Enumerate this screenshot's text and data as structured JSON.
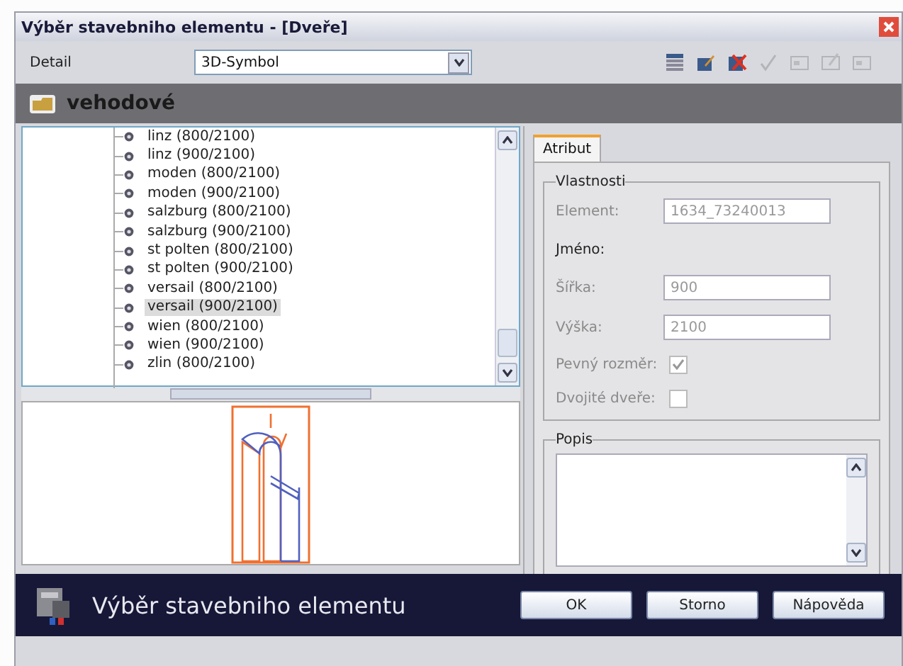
{
  "window": {
    "title": "Výběr stavebniho elementu - [Dveře]"
  },
  "toolbar": {
    "label": "Detail",
    "select_value": "3D-Symbol",
    "tools": [
      {
        "kind": "list",
        "disabled": false
      },
      {
        "kind": "edit",
        "disabled": false
      },
      {
        "kind": "delete",
        "disabled": false
      },
      {
        "kind": "check",
        "disabled": true
      },
      {
        "kind": "frame",
        "disabled": true
      },
      {
        "kind": "frame-edit",
        "disabled": true
      },
      {
        "kind": "frame",
        "disabled": true
      }
    ]
  },
  "header": {
    "title": "vehodové"
  },
  "tree": {
    "items": [
      {
        "label": "linz (800/2100)",
        "selected": false
      },
      {
        "label": "linz (900/2100)",
        "selected": false
      },
      {
        "label": "moden (800/2100)",
        "selected": false
      },
      {
        "label": "moden (900/2100)",
        "selected": false
      },
      {
        "label": "salzburg (800/2100)",
        "selected": false
      },
      {
        "label": "salzburg (900/2100)",
        "selected": false
      },
      {
        "label": "st polten (800/2100)",
        "selected": false
      },
      {
        "label": "st polten (900/2100)",
        "selected": false
      },
      {
        "label": "versail (800/2100)",
        "selected": false
      },
      {
        "label": "versail (900/2100)",
        "selected": true
      },
      {
        "label": "wien (800/2100)",
        "selected": false
      },
      {
        "label": "wien (900/2100)",
        "selected": false
      },
      {
        "label": "zlin (800/2100)",
        "selected": false
      }
    ]
  },
  "tabs": [
    {
      "label": "Atribut",
      "selected": true
    }
  ],
  "properties": {
    "title": "Vlastnosti",
    "rows": [
      {
        "kind": "field",
        "label": "Element:",
        "value": "1634_73240013",
        "disabled": true
      },
      {
        "kind": "heading",
        "label": "Jméno:"
      },
      {
        "kind": "field",
        "label": "Šířka:",
        "value": "900",
        "disabled": true
      },
      {
        "kind": "field",
        "label": "Výška:",
        "value": "2100",
        "disabled": true
      },
      {
        "kind": "checkbox",
        "label": "Pevný rozměr:",
        "checked": true,
        "disabled": true
      },
      {
        "kind": "checkbox",
        "label": "Dvojité dveře:",
        "checked": false,
        "disabled": true
      }
    ]
  },
  "description": {
    "title": "Popis"
  },
  "footer": {
    "title": "Výběr stavebniho elementu",
    "buttons": [
      "OK",
      "Storno",
      "Nápověda"
    ]
  }
}
